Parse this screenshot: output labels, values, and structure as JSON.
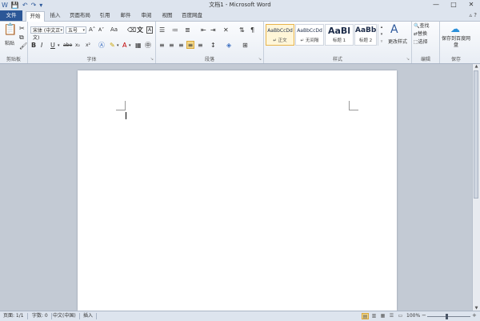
{
  "window": {
    "title": "文档1 - Microsoft Word",
    "quick_access": [
      "W",
      "💾",
      "↶",
      "↷",
      "▾"
    ],
    "controls": [
      "—",
      "□",
      "✕"
    ]
  },
  "tabs": [
    "文件",
    "开始",
    "插入",
    "页面布局",
    "引用",
    "邮件",
    "审阅",
    "视图",
    "百度网盘"
  ],
  "active_tab": "开始",
  "tab_controls": "▵ ?",
  "ribbon": {
    "clipboard": {
      "label": "剪贴板",
      "paste": "粘贴"
    },
    "font": {
      "label": "字体",
      "font_name": "宋体 (中文正文)",
      "font_size": "五号",
      "grow": "A˄",
      "shrink": "A˅",
      "case": "Aa",
      "bold": "B",
      "italic": "I",
      "underline": "U",
      "strike": "abe",
      "subscript": "x₂",
      "superscript": "x²",
      "color_letter": "A"
    },
    "paragraph": {
      "label": "段落"
    },
    "styles": {
      "label": "样式",
      "items": [
        {
          "preview": "AaBbCcDd",
          "name": "↵ 正文"
        },
        {
          "preview": "AaBbCcDd",
          "name": "↵ 无间隔"
        },
        {
          "preview": "AaBl",
          "name": "标题 1"
        },
        {
          "preview": "AaBbC",
          "name": "标题 2"
        }
      ],
      "change_styles": "更改样式"
    },
    "editing": {
      "label": "编辑",
      "find": "查找",
      "replace": "替换",
      "select": "选择"
    },
    "save": {
      "label": "保存",
      "save_to": "保存到百度网盘"
    }
  },
  "statusbar": {
    "page": "页面: 1/1",
    "words": "字数: 0",
    "language": "中文(中国)",
    "mode": "插入",
    "zoom": "100%",
    "zoom_minus": "−",
    "zoom_plus": "+"
  },
  "colors": {
    "file_tab": "#2b5797",
    "ribbon_bg": "#f3f6fa",
    "selected_style": "#e8b44b",
    "background": "#c3cad4"
  }
}
